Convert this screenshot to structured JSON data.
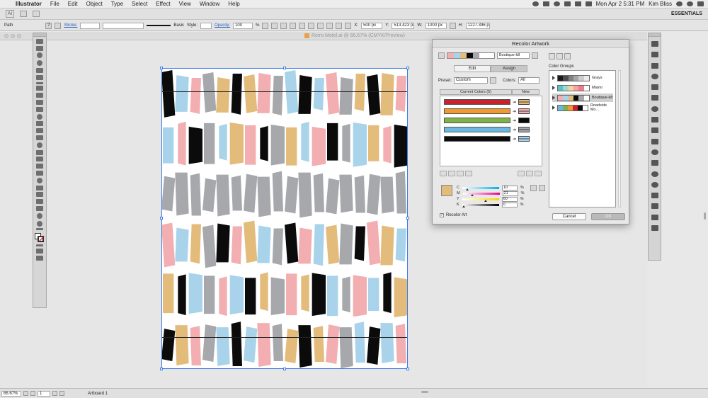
{
  "menubar": {
    "app": "Illustrator",
    "items": [
      "File",
      "Edit",
      "Object",
      "Type",
      "Select",
      "Effect",
      "View",
      "Window",
      "Help"
    ],
    "datetime": "Mon Apr 2  5:31 PM",
    "user": "Kim Bliss"
  },
  "appbar": {
    "workspace": "ESSENTIALS"
  },
  "controlbar": {
    "object_type": "Path",
    "stroke_label": "Stroke:",
    "brush": "Basic",
    "style_label": "Style:",
    "opacity_label": "Opacity:",
    "opacity": "100",
    "opacity_unit": "%",
    "x_label": "X:",
    "x": "500 px",
    "y_label": "Y:",
    "y": "513.423 px",
    "w_label": "W:",
    "w": "1000 px",
    "h_label": "H:",
    "h": "1227.396 p"
  },
  "document": {
    "title": "Retro Motel.ai @ 66.67% (CMYK/Preview)"
  },
  "statusbar": {
    "zoom": "66.67%",
    "artboard_number": "1",
    "artboard_label": "Artboard 1"
  },
  "palette": {
    "pink": "#f2aeb0",
    "blue": "#a9d3ea",
    "tan": "#e3bb7b",
    "gray": "#a7a8ac",
    "black": "#0b0b0b"
  },
  "dialog": {
    "title": "Recolor Artwork",
    "harmony_name": "Boutique-k8",
    "tabs": [
      "Edit",
      "Assign"
    ],
    "active_tab": "Assign",
    "preset_label": "Preset:",
    "preset_value": "Custom",
    "colors_label": "Colors:",
    "colors_value": "All",
    "current_colors_header": "Current Colors (5)",
    "new_header": "New",
    "color_rows": [
      {
        "current": "#c8232c",
        "new": "#e3bb7b"
      },
      {
        "current": "#f29a2e",
        "new": "#f2aeb0"
      },
      {
        "current": "#7fb24a",
        "new": "#0b0b0b"
      },
      {
        "current": "#6cb7df",
        "new": "#a7a8ac"
      },
      {
        "current": "#0b0b0b",
        "new": "#a9d3ea"
      }
    ],
    "cmyk": [
      {
        "label": "C",
        "value": "10",
        "unit": "%"
      },
      {
        "label": "M",
        "value": "21",
        "unit": "%"
      },
      {
        "label": "Y",
        "value": "60",
        "unit": "%"
      },
      {
        "label": "K",
        "value": "0",
        "unit": "%"
      }
    ],
    "recolor_art_label": "Recolor Art",
    "color_groups_label": "Color Groups",
    "color_groups": [
      {
        "name": "Grays",
        "colors": [
          "#1a1a1a",
          "#4d4d4d",
          "#808080",
          "#a6a6a6",
          "#cccccc",
          "#ebebeb"
        ]
      },
      {
        "name": "Miami",
        "colors": [
          "#57c4c4",
          "#9dd9d2",
          "#f7d59a",
          "#f5a3a3",
          "#f07a8a",
          "#ffffff"
        ]
      },
      {
        "name": "Boutique-k8",
        "colors": [
          "#f2aeb0",
          "#a9d3ea",
          "#e3bb7b",
          "#0b0b0b",
          "#a7a8ac",
          "#ffffff"
        ]
      },
      {
        "name": "Roadside Mo...",
        "colors": [
          "#6cb7df",
          "#7fb24a",
          "#f29a2e",
          "#c8232c",
          "#0b0b0b",
          "#ffffff"
        ]
      }
    ],
    "cancel_label": "Cancel",
    "ok_label": "OK"
  }
}
